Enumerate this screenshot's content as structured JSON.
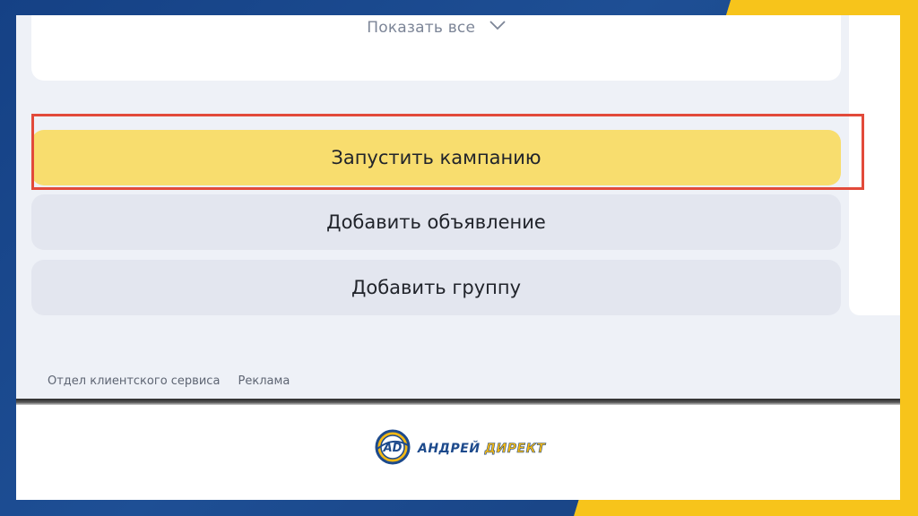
{
  "ad_campaign_page": {
    "show_all_label": "Показать все",
    "launch_campaign_label": "Запустить кампанию",
    "add_ad_label": "Добавить объявление",
    "add_group_label": "Добавить группу",
    "footer_links": [
      "Отдел клиентского сервиса",
      "Реклама"
    ]
  },
  "branding": {
    "logo_text_part1": "АНДРЕЙ",
    "logo_text_part2": "ДИРЕКТ",
    "logo_emblem_text": "AD"
  },
  "colors": {
    "frame_blue": "#1d4a8c",
    "frame_yellow": "#f7c41b",
    "launch_button": "#f8dd6e",
    "secondary_button": "#e3e6ef",
    "highlight_border": "#e24a3a",
    "page_background": "#eef1f7"
  },
  "icons": {
    "show_all": "chevron-down-icon",
    "logo": "logo-emblem-icon"
  }
}
